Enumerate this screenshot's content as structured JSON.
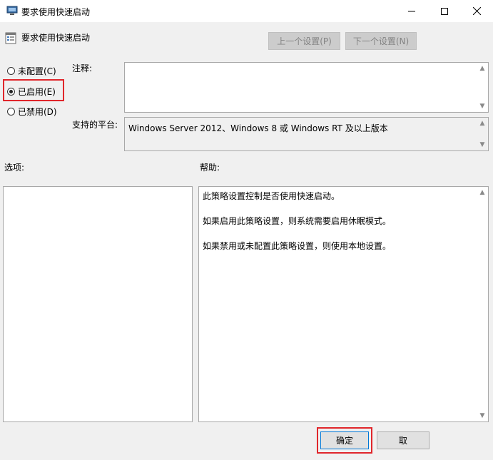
{
  "window": {
    "title": "要求使用快速启动",
    "controls": {
      "minimize": "—",
      "maximize": "☐",
      "close": "✕"
    }
  },
  "header": {
    "policy_name": "要求使用快速启动",
    "prev_setting_label": "上一个设置(P)",
    "next_setting_label": "下一个设置(N)"
  },
  "state_options": [
    {
      "label": "未配置(C)",
      "selected": false
    },
    {
      "label": "已启用(E)",
      "selected": true
    },
    {
      "label": "已禁用(D)",
      "selected": false
    }
  ],
  "comment": {
    "label": "注释:",
    "value": ""
  },
  "platform": {
    "label": "支持的平台:",
    "value": "Windows Server 2012、Windows 8 或 Windows RT 及以上版本"
  },
  "options": {
    "label": "选项:"
  },
  "help": {
    "label": "帮助:",
    "paragraphs": [
      "此策略设置控制是否使用快速启动。",
      "如果启用此策略设置，则系统需要启用休眠模式。",
      "如果禁用或未配置此策略设置，则使用本地设置。"
    ]
  },
  "footer": {
    "ok_label": "确定",
    "cancel_label": "取"
  },
  "colors": {
    "highlight": "#e0262b",
    "window_bg": "#f0f0f0",
    "disabled_text": "#838383"
  }
}
